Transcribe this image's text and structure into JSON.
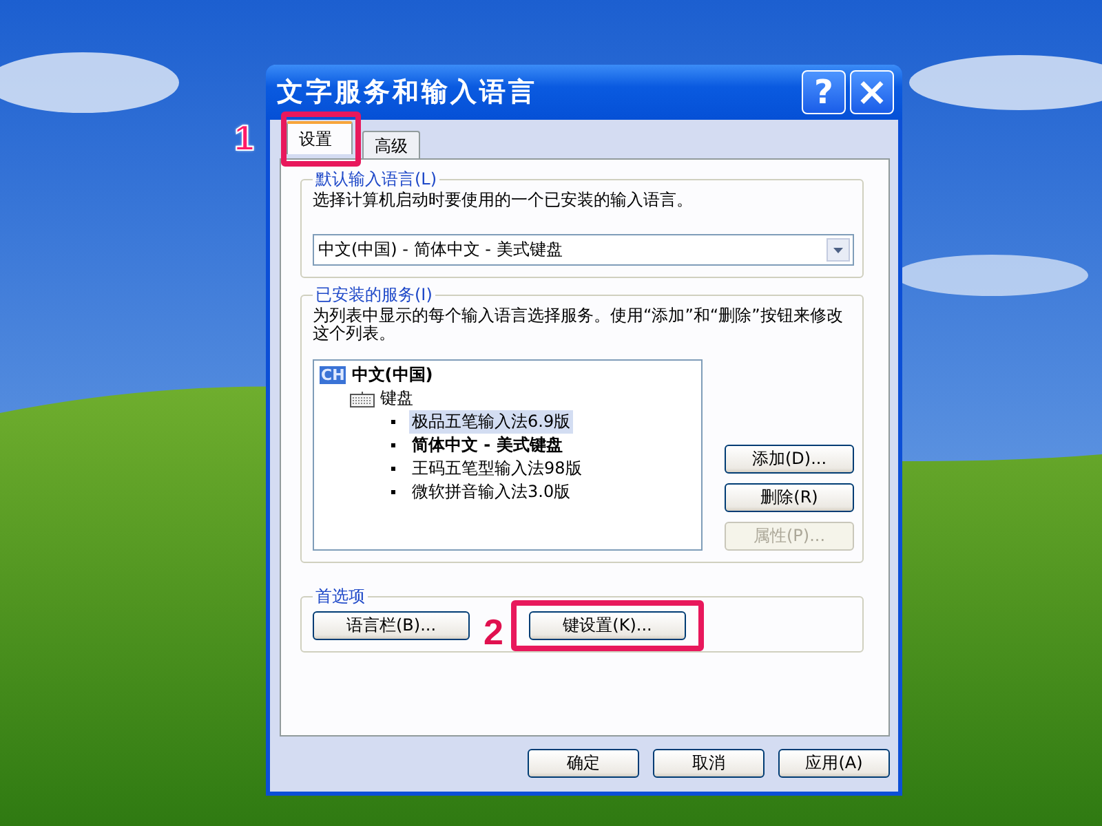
{
  "window": {
    "title": "文字服务和输入语言",
    "title_buttons": [
      {
        "kind": "help",
        "label": "?"
      },
      {
        "kind": "close",
        "label": "×"
      }
    ]
  },
  "tabs": [
    {
      "label": "设置",
      "selected": true,
      "step": "1"
    },
    {
      "label": "高级",
      "selected": false
    }
  ],
  "default_language": {
    "legend": "默认输入语言(L)",
    "description": "选择计算机启动时要使用的一个已安装的输入语言。",
    "value": "中文(中国) - 简体中文 - 美式键盘"
  },
  "services": {
    "legend": "已安装的服务(I)",
    "description": "为列表中显示的每个输入语言选择服务。使用“添加”和“删除”按钮来修改这个列表。",
    "tree": [
      {
        "badge": "CH",
        "label": "中文(中国)",
        "children": [
          {
            "label": "键盘",
            "children": [
              {
                "label": "极品五笔输入法6.9版",
                "selected": true,
                "default": false
              },
              {
                "label": "简体中文 - 美式键盘",
                "selected": false,
                "default": true
              },
              {
                "label": "王码五笔型输入法98版",
                "selected": false,
                "default": false
              },
              {
                "label": "微软拼音输入法3.0版",
                "selected": false,
                "default": false
              }
            ]
          }
        ]
      }
    ],
    "buttons": [
      {
        "label": "添加(D)...",
        "disabled": false
      },
      {
        "label": "删除(R)",
        "disabled": false
      },
      {
        "label": "属性(P)...",
        "disabled": true
      }
    ]
  },
  "preferences": {
    "legend": "首选项",
    "buttons": [
      {
        "label": "语言栏(B)..."
      },
      {
        "label": "键设置(K)...",
        "step": "2"
      }
    ]
  },
  "footer_buttons": [
    {
      "label": "确定"
    },
    {
      "label": "取消"
    },
    {
      "label": "应用(A)"
    }
  ]
}
